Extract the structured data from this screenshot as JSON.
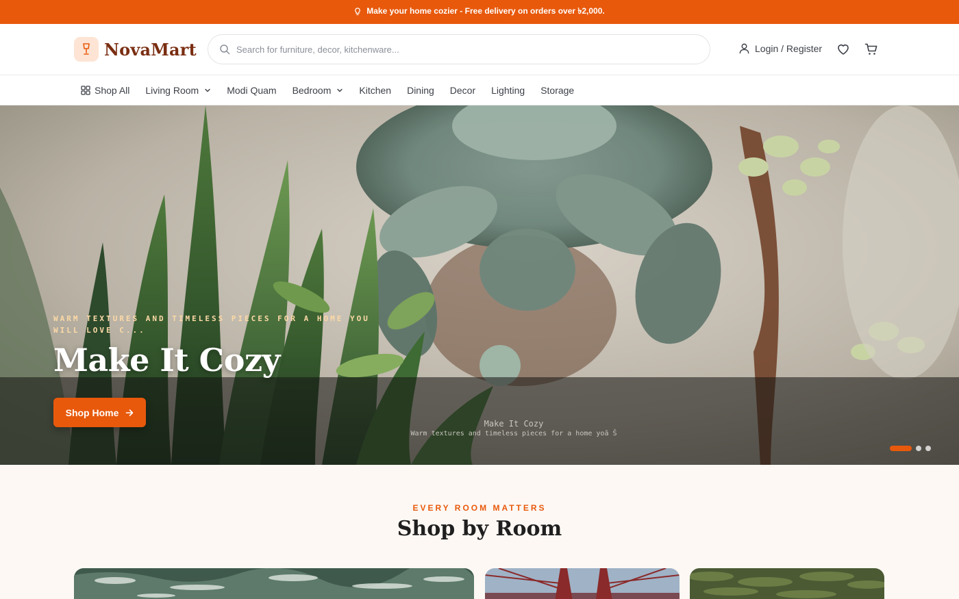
{
  "announcement": {
    "text": "Make your home cozier - Free delivery on orders over ৳2,000.",
    "icon": "lightbulb-icon"
  },
  "brand": {
    "name": "NovaMart",
    "accent": "#e8590c",
    "logo_bg": "#fde4d4",
    "logo_text_color": "#7a2e12"
  },
  "search": {
    "placeholder": "Search for furniture, decor, kitchenware..."
  },
  "header": {
    "login_label": "Login / Register",
    "wishlist_icon": "heart-icon",
    "cart_icon": "cart-icon"
  },
  "nav": {
    "items": [
      {
        "label": "Shop All",
        "icon": "grid-icon"
      },
      {
        "label": "Living Room",
        "dropdown": true
      },
      {
        "label": "Modi Quam"
      },
      {
        "label": "Bedroom",
        "dropdown": true
      },
      {
        "label": "Kitchen"
      },
      {
        "label": "Dining"
      },
      {
        "label": "Decor"
      },
      {
        "label": "Lighting"
      },
      {
        "label": "Storage"
      }
    ]
  },
  "hero": {
    "eyebrow": "WARM TEXTURES AND TIMELESS PIECES FOR A HOME YOU WILL LOVE C...",
    "title": "Make It Cozy",
    "button_label": "Shop Home",
    "image_alt_title": "Make It Cozy",
    "image_alt_sub": "Warm textures and timeless pieces for a home yoâ Š",
    "slides_total": 3,
    "active_slide": 1
  },
  "section": {
    "eyebrow": "EVERY ROOM MATTERS",
    "title": "Shop by Room"
  }
}
